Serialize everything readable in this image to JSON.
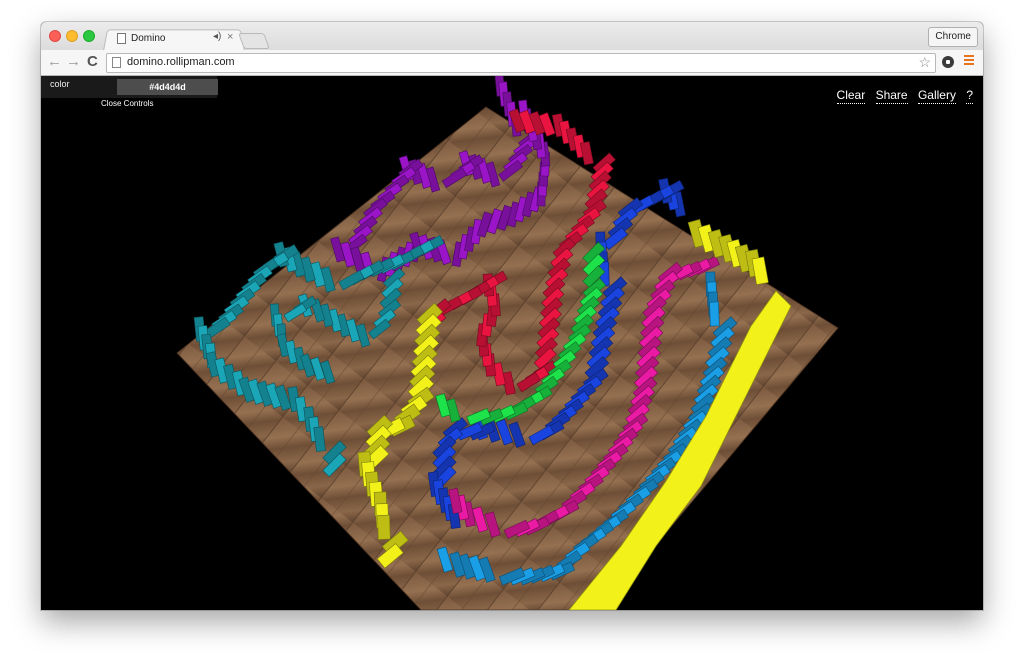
{
  "browser": {
    "tab_title": "Domino",
    "url": "domino.rollipman.com",
    "profile_label": "Chrome",
    "nav_back_icon": "←",
    "nav_forward_icon": "→",
    "reload_icon": "C",
    "tab_audio_icon": "◂)",
    "tab_close_icon": "×",
    "bookmark_icon": "☆"
  },
  "controls": {
    "color_label": "color",
    "color_value": "#4d4d4d",
    "close_label": "Close Controls"
  },
  "toplinks": {
    "clear": "Clear",
    "share": "Share",
    "gallery": "Gallery",
    "help": "?"
  },
  "colors": {
    "purple": "#9a14c8",
    "red": "#ea1440",
    "blue": "#1a44e0",
    "green": "#1ee24a",
    "magenta": "#ea1aa4",
    "cyan": "#1a9ee6",
    "teal": "#1aa6b6",
    "yellow": "#f2f21a"
  }
}
